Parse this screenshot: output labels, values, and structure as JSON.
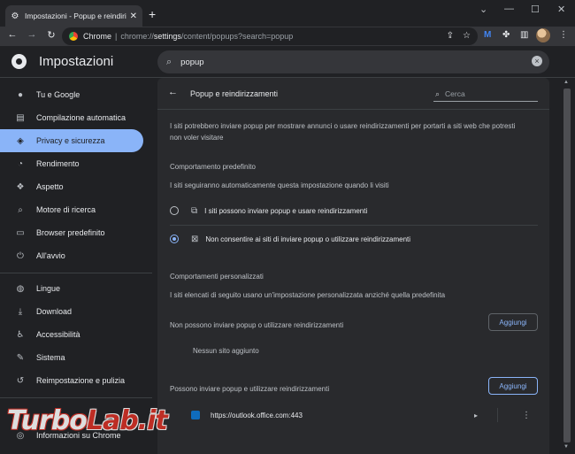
{
  "browser": {
    "tab_title": "Impostazioni - Popup e reindirizzamenti",
    "tab_close": "✕",
    "new_tab": "+",
    "omnibox_host": "Chrome",
    "omnibox_separator": "|",
    "omnibox_scheme": "chrome://",
    "omnibox_path_bold": "settings",
    "omnibox_path_rest": "/content/popups?search=popup",
    "colors": {
      "frame": "#202124",
      "toolbar": "#35363a",
      "accent": "#8ab4f8"
    }
  },
  "header": {
    "title": "Impostazioni",
    "search_value": "popup"
  },
  "sidebar": {
    "items": [
      {
        "label": "Tu e Google",
        "icon": "person-icon"
      },
      {
        "label": "Compilazione automatica",
        "icon": "clipboard-icon"
      },
      {
        "label": "Privacy e sicurezza",
        "icon": "shield-icon",
        "active": true
      },
      {
        "label": "Rendimento",
        "icon": "speedometer-icon"
      },
      {
        "label": "Aspetto",
        "icon": "palette-icon"
      },
      {
        "label": "Motore di ricerca",
        "icon": "search-icon"
      },
      {
        "label": "Browser predefinito",
        "icon": "browser-icon"
      },
      {
        "label": "All'avvio",
        "icon": "power-icon"
      },
      {
        "label": "Lingue",
        "icon": "globe-icon"
      },
      {
        "label": "Download",
        "icon": "download-icon"
      },
      {
        "label": "Accessibilità",
        "icon": "accessibility-icon"
      },
      {
        "label": "Sistema",
        "icon": "wrench-icon"
      },
      {
        "label": "Reimpostazione e pulizia",
        "icon": "reset-icon"
      },
      {
        "label": "Informazioni su Chrome",
        "icon": "chrome-icon"
      }
    ]
  },
  "card": {
    "title": "Popup e reindirizzamenti",
    "search_placeholder": "Cerca",
    "intro_line1": "I siti potrebbero inviare popup per mostrare annunci o usare reindirizzamenti per portarti a siti web che potresti",
    "intro_line2": "non voler visitare",
    "default_heading": "Comportamento predefinito",
    "default_desc": "I siti seguiranno automaticamente questa impostazione quando li visiti",
    "option_allow": "I siti possono inviare popup e usare reindirizzamenti",
    "option_block": "Non consentire ai siti di inviare popup o utilizzare reindirizzamenti",
    "selected_option": "block",
    "custom_heading": "Comportamenti personalizzati",
    "custom_desc": "I siti elencati di seguito usano un'impostazione personalizzata anziché quella predefinita",
    "blocked_label": "Non possono inviare popup o utilizzare reindirizzamenti",
    "add_label": "Aggiungi",
    "blocked_empty": "Nessun sito aggiunto",
    "allowed_label": "Possono inviare popup e utilizzare reindirizzamenti",
    "allowed_sites": [
      {
        "url": "https://outlook.office.com:443"
      }
    ]
  },
  "watermark": {
    "part1": "Turbo",
    "part2": "Lab.it"
  }
}
